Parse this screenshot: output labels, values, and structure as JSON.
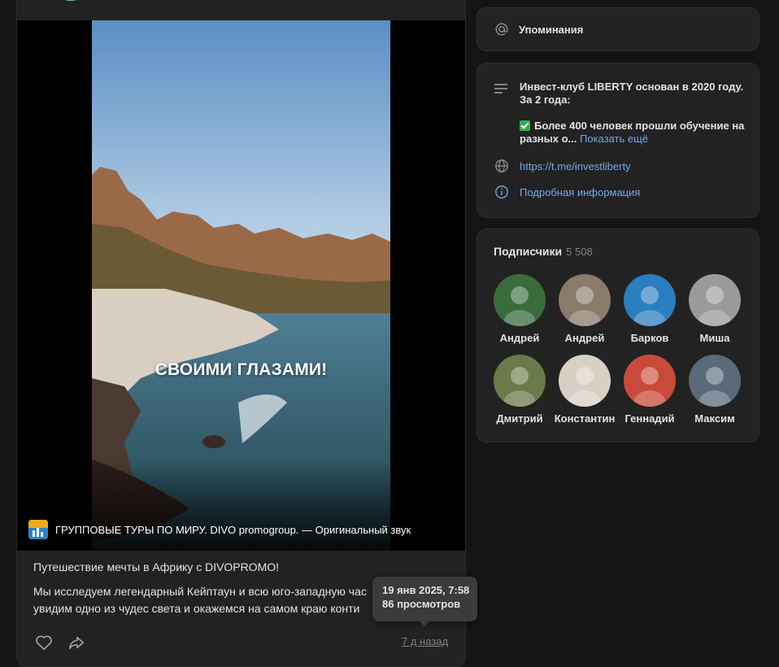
{
  "post": {
    "video_caption": "СВОИМИ ГЛАЗАМИ!",
    "sound_text": "ГРУППОВЫЕ ТУРЫ ПО МИРУ. DIVO promogroup. — Оригинальный звук",
    "title": "Путешествие мечты в Африку с DIVOPROMO!",
    "body_line1": "Мы исследуем легендарный Кейптаун и всю юго-западную час",
    "body_line2": "увидим одно из чудес света и окажемся на самом краю конти",
    "time_ago": "7 д назад",
    "tooltip_date": "19 янв 2025, 7:58",
    "tooltip_views": "86 просмотров",
    "icons": [
      "heart-icon",
      "share-icon"
    ]
  },
  "mentions": {
    "label": "Упоминания",
    "icon": "at-icon"
  },
  "info": {
    "description": "Инвест-клуб LIBERTY основан в 2020 году. За 2 года:",
    "description2": "Более 400 человек прошли обучение на разных о...",
    "show_more": "Показать ещё",
    "link": "https://t.me/investliberty",
    "details": "Подробная информация"
  },
  "subscribers": {
    "title": "Подписчики",
    "count": "5 508",
    "people": [
      {
        "name": "Андрей",
        "color": "#3a6b3c"
      },
      {
        "name": "Андрей",
        "color": "#8a7a6a"
      },
      {
        "name": "Барков",
        "color": "#2a7fc1"
      },
      {
        "name": "Миша",
        "color": "#9a9a9a"
      },
      {
        "name": "Дмитрий",
        "color": "#6a7a4a"
      },
      {
        "name": "Константин",
        "color": "#d8d0c4"
      },
      {
        "name": "Геннадий",
        "color": "#c94a3a"
      },
      {
        "name": "Максим",
        "color": "#5a6a7a"
      }
    ]
  }
}
